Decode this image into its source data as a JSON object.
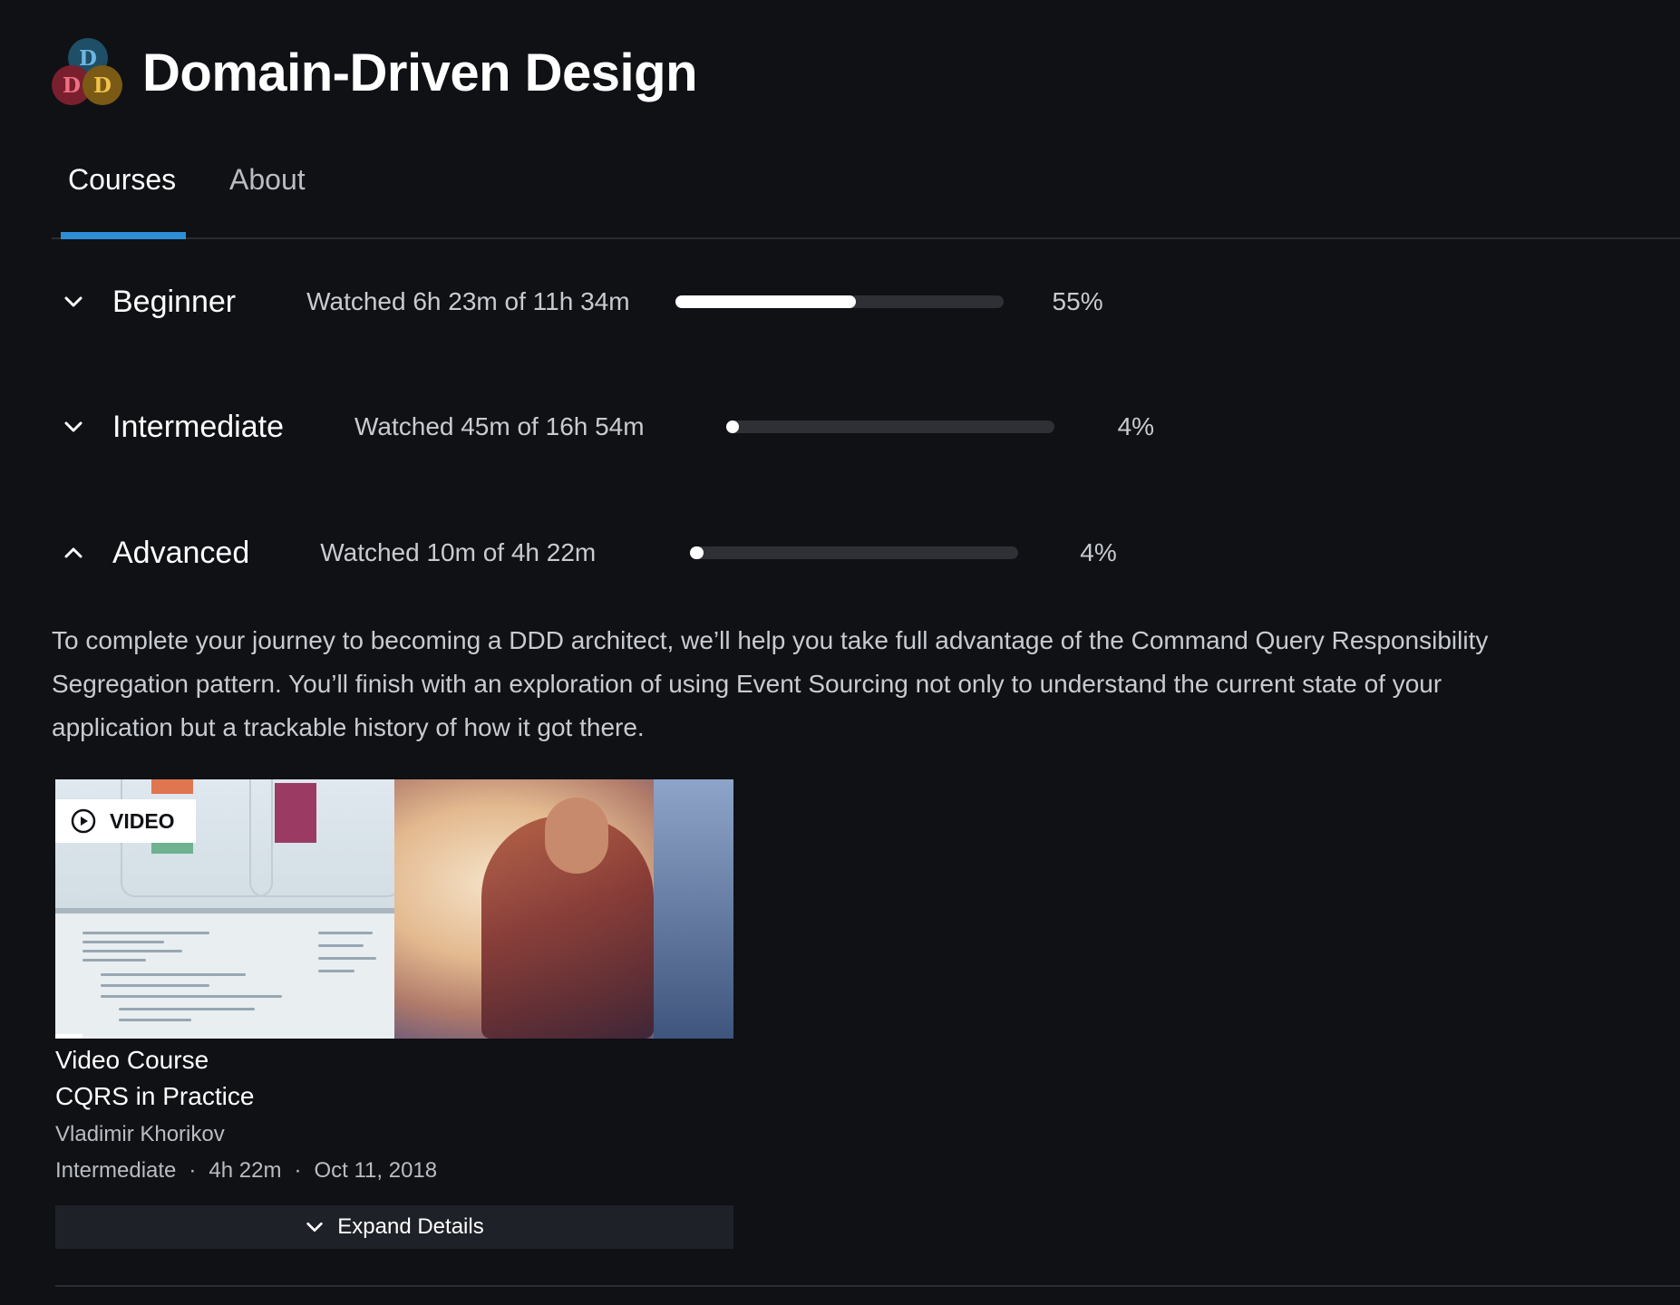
{
  "header": {
    "title": "Domain-Driven Design",
    "logo_letters": [
      "D",
      "D",
      "D"
    ]
  },
  "tabs": [
    {
      "label": "Courses",
      "active": true
    },
    {
      "label": "About",
      "active": false
    }
  ],
  "accent_color": "#2d8ed6",
  "levels": [
    {
      "name": "Beginner",
      "watched": "Watched 6h 23m of 11h 34m",
      "percent_label": "55%",
      "progress": 0.55,
      "expanded": false,
      "icon": "chevron-down-icon"
    },
    {
      "name": "Intermediate",
      "watched": "Watched 45m of 16h 54m",
      "percent_label": "4%",
      "progress": 0.04,
      "expanded": false,
      "icon": "chevron-down-icon"
    },
    {
      "name": "Advanced",
      "watched": "Watched 10m of 4h 22m",
      "percent_label": "4%",
      "progress": 0.04,
      "expanded": true,
      "icon": "chevron-up-icon"
    }
  ],
  "advanced_description": "To complete your journey to becoming a DDD architect, we’ll help you take full advantage of the Command Query Responsibility Segregation pattern. You’ll finish with an exploration of using Event Sourcing not only to understand the current state of your application but a trackable history of how it got there.",
  "course_card": {
    "badge_label": "VIDEO",
    "badge_icon": "play-circle-icon",
    "type": "Video Course",
    "title": "CQRS in Practice",
    "author": "Vladimir Khorikov",
    "level": "Intermediate",
    "duration": "4h 22m",
    "date": "Oct 11, 2018",
    "separator": "·",
    "expand_label": "Expand Details",
    "expand_icon": "chevron-down-icon"
  }
}
